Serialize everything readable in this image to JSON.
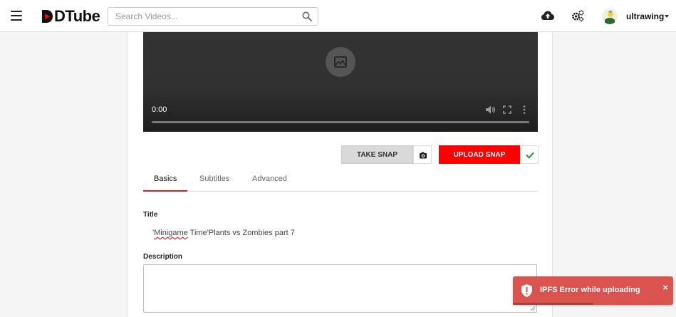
{
  "header": {
    "brand": "DTube",
    "search_placeholder": "Search Videos...",
    "username": "ultrawing",
    "icons": [
      "menu-icon",
      "search-icon",
      "cloud-upload-icon",
      "settings-gears-icon",
      "chevron-down-icon"
    ]
  },
  "player": {
    "time": "0:00",
    "icons": [
      "image-placeholder-icon",
      "volume-icon",
      "fullscreen-icon",
      "more-vertical-icon"
    ]
  },
  "snap": {
    "take_label": "TAKE SNAP",
    "upload_label": "UPLOAD SNAP",
    "icons": [
      "camera-icon",
      "checkmark-icon"
    ]
  },
  "tabs": [
    {
      "label": "Basics",
      "active": true
    },
    {
      "label": "Subtitles",
      "active": false
    },
    {
      "label": "Advanced",
      "active": false
    }
  ],
  "form": {
    "title_label": "Title",
    "title_value_pre": "'",
    "title_value_misspelled": "Minigame",
    "title_value_post": " Time'Plants vs Zombies part 7",
    "description_label": "Description",
    "description_value": ""
  },
  "toast": {
    "message": "IPFS Error while uploading",
    "close_glyph": "×",
    "color": "#d9534f"
  },
  "colors": {
    "accent": "#ff0000",
    "tab_underline": "#e02020"
  }
}
